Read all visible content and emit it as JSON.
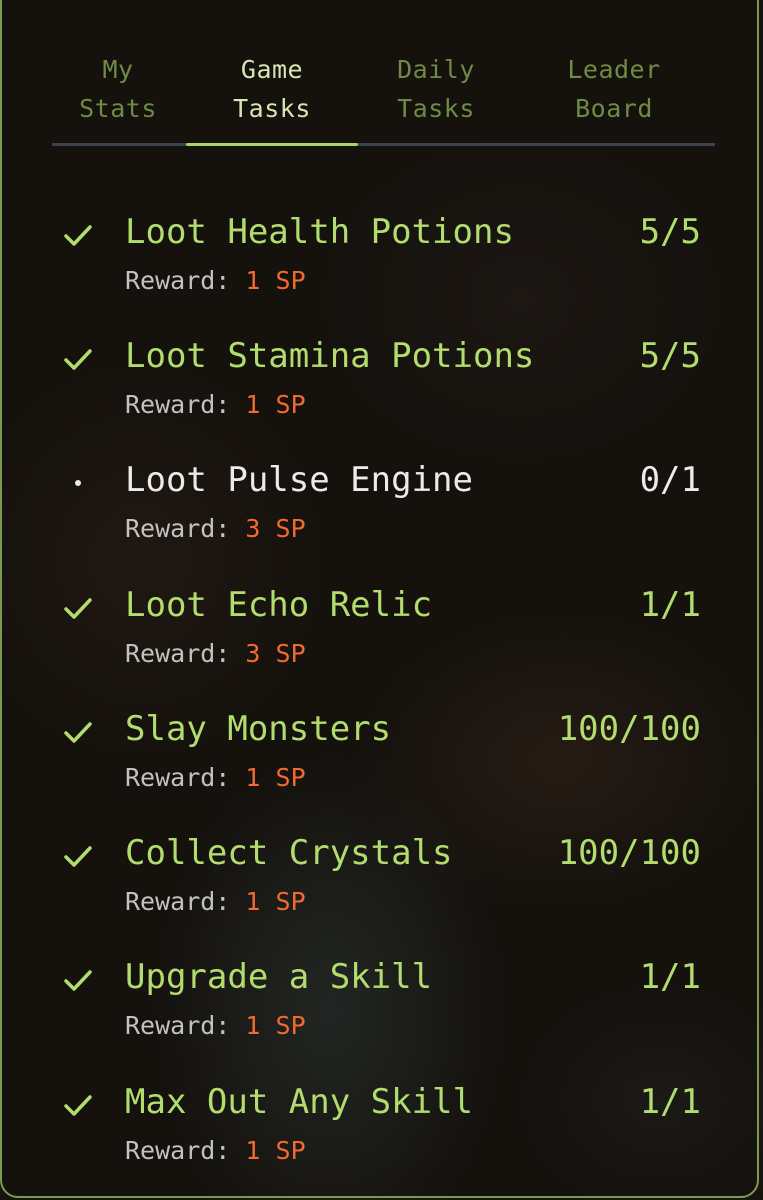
{
  "tabs": [
    {
      "label": "My\nStats"
    },
    {
      "label": "Game\nTasks"
    },
    {
      "label": "Daily\nTasks"
    },
    {
      "label": "Leader\nBoard"
    }
  ],
  "active_tab": "Game Tasks",
  "reward_label": "Reward:",
  "tasks": [
    {
      "title": "Loot Health Potions",
      "progress": "5/5",
      "reward": "1 SP",
      "status": "complete"
    },
    {
      "title": "Loot Stamina Potions",
      "progress": "5/5",
      "reward": "1 SP",
      "status": "complete"
    },
    {
      "title": "Loot Pulse Engine",
      "progress": "0/1",
      "reward": "3 SP",
      "status": "pending"
    },
    {
      "title": "Loot Echo Relic",
      "progress": "1/1",
      "reward": "3 SP",
      "status": "complete"
    },
    {
      "title": "Slay Monsters",
      "progress": "100/100",
      "reward": "1 SP",
      "status": "complete"
    },
    {
      "title": "Collect Crystals",
      "progress": "100/100",
      "reward": "1 SP",
      "status": "complete"
    },
    {
      "title": "Upgrade a Skill",
      "progress": "1/1",
      "reward": "1 SP",
      "status": "complete"
    },
    {
      "title": "Max Out Any Skill",
      "progress": "1/1",
      "reward": "1 SP",
      "status": "complete"
    }
  ],
  "icons": {
    "complete": "check-icon",
    "pending": "bullet-icon"
  },
  "colors": {
    "complete_text": "#b2dd6e",
    "pending_text": "#ebebeb",
    "reward_value": "#f26a2e",
    "active_tab": "#d8e6b4",
    "inactive_tab": "#6f8a45",
    "panel_border": "#7c9a4f"
  }
}
